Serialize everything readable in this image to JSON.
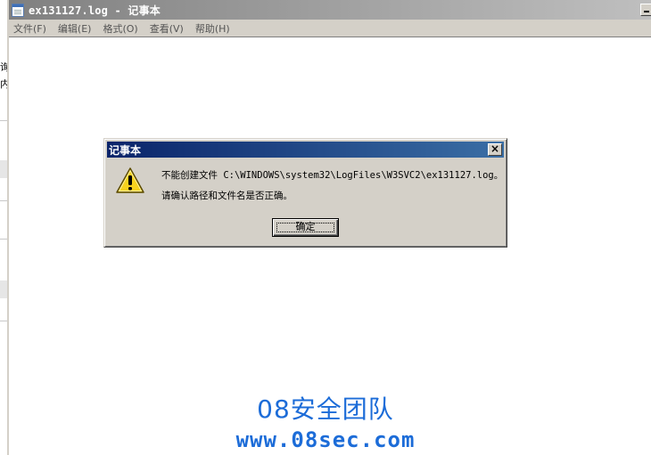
{
  "window": {
    "title": "ex131127.log - 记事本"
  },
  "menu": [
    {
      "label": "文件(F)"
    },
    {
      "label": "编辑(E)"
    },
    {
      "label": "格式(O)"
    },
    {
      "label": "查看(V)"
    },
    {
      "label": "帮助(H)"
    }
  ],
  "dialog": {
    "title": "记事本",
    "close_label": "×",
    "message_line1": "不能创建文件 C:\\WINDOWS\\system32\\LogFiles\\W3SVC2\\ex131127.log。",
    "message_line2": "请确认路径和文件名是否正确。",
    "ok_label": "确定",
    "icon": "warning-icon"
  },
  "background_window": {
    "fragment1": "询",
    "fragment2": "内"
  },
  "watermark": {
    "name": "08安全团队",
    "url": "www.08sec.com"
  },
  "colors": {
    "title_active": "#0a246a",
    "title_inactive": "#808080",
    "face": "#d4d0c8",
    "watermark": "#1c6cd8",
    "warning_yellow": "#f7d21e"
  }
}
